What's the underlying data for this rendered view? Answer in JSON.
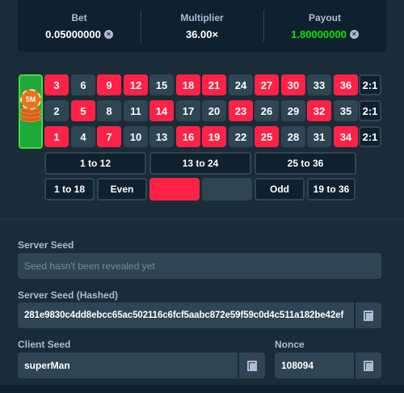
{
  "stats": {
    "bet": {
      "label": "Bet",
      "value": "0.05000000",
      "icon": "coin-icon"
    },
    "multiplier": {
      "label": "Multiplier",
      "value": "36.00×"
    },
    "payout": {
      "label": "Payout",
      "value": "1.80000000",
      "icon": "coin-icon",
      "color": "#00e701"
    }
  },
  "board": {
    "zero_chip": {
      "label": "5M",
      "color": "#e8741f"
    },
    "rows": [
      [
        {
          "n": "3",
          "c": "red"
        },
        {
          "n": "6",
          "c": "black"
        },
        {
          "n": "9",
          "c": "red"
        },
        {
          "n": "12",
          "c": "red"
        },
        {
          "n": "15",
          "c": "black"
        },
        {
          "n": "18",
          "c": "red"
        },
        {
          "n": "21",
          "c": "red"
        },
        {
          "n": "24",
          "c": "black"
        },
        {
          "n": "27",
          "c": "red"
        },
        {
          "n": "30",
          "c": "red"
        },
        {
          "n": "33",
          "c": "black"
        },
        {
          "n": "36",
          "c": "red"
        }
      ],
      [
        {
          "n": "2",
          "c": "black"
        },
        {
          "n": "5",
          "c": "red"
        },
        {
          "n": "8",
          "c": "black"
        },
        {
          "n": "11",
          "c": "black"
        },
        {
          "n": "14",
          "c": "red"
        },
        {
          "n": "17",
          "c": "black"
        },
        {
          "n": "20",
          "c": "black"
        },
        {
          "n": "23",
          "c": "red"
        },
        {
          "n": "26",
          "c": "black"
        },
        {
          "n": "29",
          "c": "black"
        },
        {
          "n": "32",
          "c": "red"
        },
        {
          "n": "35",
          "c": "black"
        }
      ],
      [
        {
          "n": "1",
          "c": "red"
        },
        {
          "n": "4",
          "c": "black"
        },
        {
          "n": "7",
          "c": "red"
        },
        {
          "n": "10",
          "c": "black"
        },
        {
          "n": "13",
          "c": "black"
        },
        {
          "n": "16",
          "c": "red"
        },
        {
          "n": "19",
          "c": "red"
        },
        {
          "n": "22",
          "c": "black"
        },
        {
          "n": "25",
          "c": "red"
        },
        {
          "n": "28",
          "c": "black"
        },
        {
          "n": "31",
          "c": "black"
        },
        {
          "n": "34",
          "c": "red"
        }
      ]
    ],
    "column_bets": [
      "2:1",
      "2:1",
      "2:1"
    ],
    "dozens": [
      "1 to 12",
      "13 to 24",
      "25 to 36"
    ],
    "outside": {
      "low": "1 to 18",
      "even": "Even",
      "odd": "Odd",
      "high": "19 to 36"
    },
    "colors": {
      "red": "#fe2247",
      "black": "#2f4553",
      "green": "#1fa83b"
    }
  },
  "fairness": {
    "server_seed": {
      "label": "Server Seed",
      "placeholder": "Seed hasn't been revealed yet"
    },
    "server_seed_hashed": {
      "label": "Server Seed (Hashed)",
      "value": "281e9830c4dd8ebcc65ac502116c6fcf5aabc872e59f59c0d4c511a182be42ef"
    },
    "client_seed": {
      "label": "Client Seed",
      "value": "superMan"
    },
    "nonce": {
      "label": "Nonce",
      "value": "108094"
    }
  }
}
